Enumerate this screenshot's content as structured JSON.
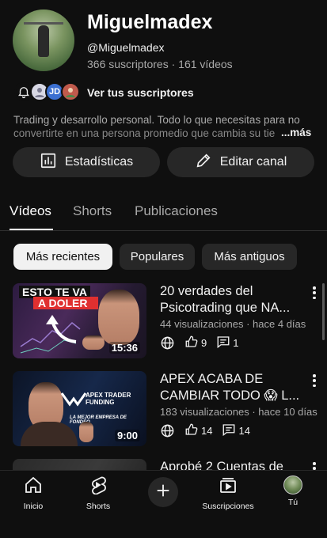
{
  "channel": {
    "name": "Miguelmadex",
    "handle": "@Miguelmadex",
    "stats": "366 suscriptores · 161 vídeos",
    "see_subscribers": "Ver tus suscriptores",
    "mini_avatar_initials": "JD",
    "description_line1": "Trading y desarrollo personal. Todo lo que necesitas para no",
    "description_line2": "convertirte en una persona promedio que cambia su tiempo",
    "more": "...más"
  },
  "actions": {
    "stats_label": "Estadísticas",
    "edit_label": "Editar canal"
  },
  "tabs": [
    {
      "label": "Vídeos",
      "active": true
    },
    {
      "label": "Shorts",
      "active": false
    },
    {
      "label": "Publicaciones",
      "active": false
    }
  ],
  "chips": [
    {
      "label": "Más recientes",
      "active": true
    },
    {
      "label": "Populares",
      "active": false
    },
    {
      "label": "Más antiguos",
      "active": false
    }
  ],
  "videos": [
    {
      "title": "20 verdades del Psicotrading que NA...",
      "meta": "44 visualizaciones · hace 4 días",
      "duration": "15:36",
      "likes": "9",
      "comments": "1",
      "thumb_line1": "ESTO TE VA",
      "thumb_line2": "A DOLER"
    },
    {
      "title": "APEX ACABA DE CAMBIAR TODO 😱 L...",
      "meta": "183 visualizaciones · hace 10 días",
      "duration": "9:00",
      "likes": "14",
      "comments": "14",
      "thumb_brand": "APEX TRADER FUNDING",
      "thumb_sub": "LA MEJOR EMPRESA DE FONDEO"
    },
    {
      "title": "Aprobé 2 Cuentas de"
    }
  ],
  "nav": {
    "home": "Inicio",
    "shorts": "Shorts",
    "subscriptions": "Suscripciones",
    "you": "Tú"
  }
}
